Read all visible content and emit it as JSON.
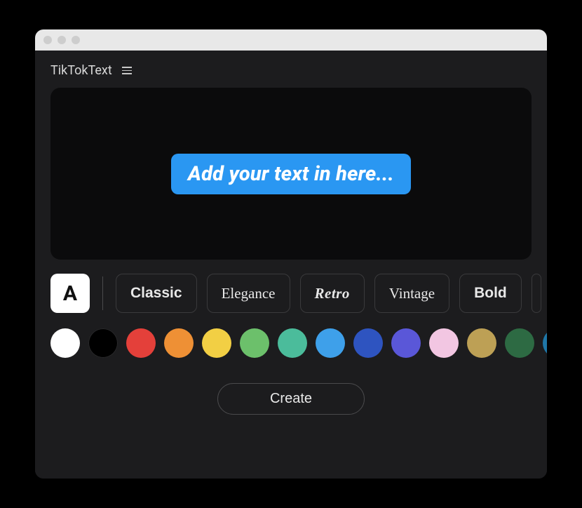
{
  "app": {
    "title": "TikTokText"
  },
  "canvas": {
    "placeholder": "Add your text in here..."
  },
  "stylePicker": {
    "letter": "A",
    "styles": [
      {
        "id": "classic",
        "label": "Classic"
      },
      {
        "id": "elegance",
        "label": "Elegance"
      },
      {
        "id": "retro",
        "label": "Retro"
      },
      {
        "id": "vintage",
        "label": "Vintage"
      },
      {
        "id": "bold",
        "label": "Bold"
      }
    ]
  },
  "colors": [
    "#ffffff",
    "#000000",
    "#e4403a",
    "#ee9035",
    "#f2cf44",
    "#6cc06b",
    "#4bbc9b",
    "#3ea0ea",
    "#2e54c0",
    "#5a57d8",
    "#f2c6e2",
    "#bda055",
    "#2d6a43",
    "#1f77a8"
  ],
  "actions": {
    "create": "Create"
  }
}
